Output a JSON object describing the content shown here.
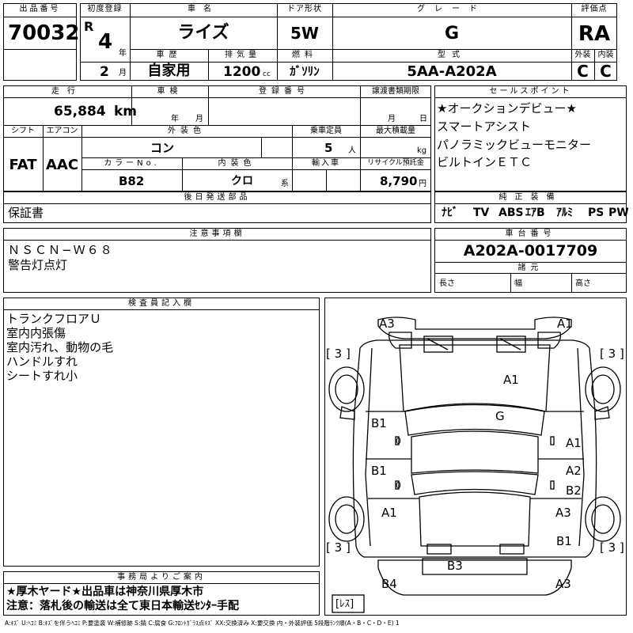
{
  "header": {
    "lot_label": "出品番号",
    "lot_value": "70032",
    "reg_label": "初度登録",
    "era": "R",
    "year": "4",
    "year_unit": "年",
    "month": "2",
    "month_unit": "月",
    "model_label": "車名",
    "model_value": "ライズ",
    "door_label": "ドア形状",
    "door_value": "5W",
    "grade_label": "グレード",
    "grade_value": "G",
    "score_label": "評価点",
    "score_value": "RA",
    "history_label": "車歴",
    "history_value": "自家用",
    "disp_label": "排気量",
    "disp_value": "1200",
    "disp_unit": "cc",
    "fuel_label": "燃料",
    "fuel_value": "ｶﾞｿﾘﾝ",
    "type_label": "型式",
    "type_value": "5AA-A202A",
    "ext_label": "外装",
    "ext_value": "C",
    "int_label": "内装",
    "int_value": "C"
  },
  "mileage": {
    "label": "走行",
    "value": "65,884",
    "unit": "km",
    "inspection_label": "車検",
    "insp_year_unit": "年",
    "insp_month_unit": "月",
    "regno_label": "登録番号",
    "transfer_label": "譲渡書類期限",
    "transfer_month": "月",
    "transfer_day": "日"
  },
  "specs": {
    "shift_label": "シフト",
    "shift_value": "FAT",
    "ac_label": "エアコン",
    "ac_value": "AAC",
    "color_label": "外装色",
    "color_value": "コン",
    "seats_label": "乗車定員",
    "seats_value": "5",
    "seats_unit": "人",
    "load_label": "最大積載量",
    "load_unit": "kg",
    "colorno_label": "カラーNo.",
    "colorno_value": "B82",
    "interior_label": "内装色",
    "interior_value": "クロ",
    "interior_unit": "系",
    "import_label": "輸入車",
    "recycle_label": "リサイクル預託金",
    "recycle_value": "8,790",
    "recycle_unit": "円"
  },
  "sales_points": {
    "label": "セールスポイント",
    "items": [
      "★オークションデビュー★",
      "スマートアシスト",
      "パノラミックビューモニター",
      "ビルトインＥＴＣ"
    ]
  },
  "later_parts": {
    "label": "後日発送部品",
    "value": "保証書"
  },
  "equipment": {
    "label": "純正装備",
    "items": [
      "ﾅﾋﾞ",
      "TV",
      "ABS",
      "ｴｱB",
      "ｱﾙﾐ",
      "PS",
      "PW"
    ]
  },
  "notes": {
    "label": "注意事項欄",
    "lines": [
      "ＮＳＣＮ−Ｗ６８",
      "警告灯点灯"
    ]
  },
  "chassis": {
    "label": "車台番号",
    "value": "A202A-0017709"
  },
  "dims": {
    "label": "諸元",
    "length": "長さ",
    "width": "幅",
    "height": "高さ"
  },
  "inspector": {
    "label": "検査員記入欄",
    "lines": [
      "トランクフロアＵ",
      "室内内張傷",
      "室内汚れ、動物の毛",
      "ハンドルすれ",
      "シートすれ小"
    ]
  },
  "office": {
    "label": "事務局よりご案内",
    "lines": [
      "★厚木ヤード★出品車は神奈川県厚木市",
      "注意：落札後の輸送は全て東日本輸送ｾﾝﾀｰ手配"
    ]
  },
  "diagram": {
    "marks": {
      "front_left": "A3",
      "front_right": "A1",
      "hood": "A1",
      "roof": "G",
      "left_front_door": "B1",
      "left_rear_door": "B1",
      "right_front_door": "A1",
      "right_rear_door_1": "A2",
      "right_rear_door_2": "B2",
      "left_rear_fender": "A1",
      "right_rear_fender": "A3",
      "right_rear_quarter": "B1",
      "rear_bumper": "B3",
      "rear_left": "B4",
      "rear_right": "A3",
      "left_front_count": "0",
      "left_rear_count": "0"
    },
    "tires": {
      "fl": "3",
      "fr": "3",
      "rl": "3",
      "rr": "3"
    },
    "spare": "ﾚｽ"
  },
  "legend": "A:ｷｽﾞ U:ﾍｺﾐ B:ｷｽﾞを伴うﾍｺﾐ P:要塗装 W:補修跡 S:錆 C:腐食 G:ﾌﾛﾝﾄｶﾞﾗｽ点ｷｽﾞ XX:交換済み X:要交換  内・外装評価  5段階ﾗﾝｸ順(A・B・C・D・E) 1"
}
